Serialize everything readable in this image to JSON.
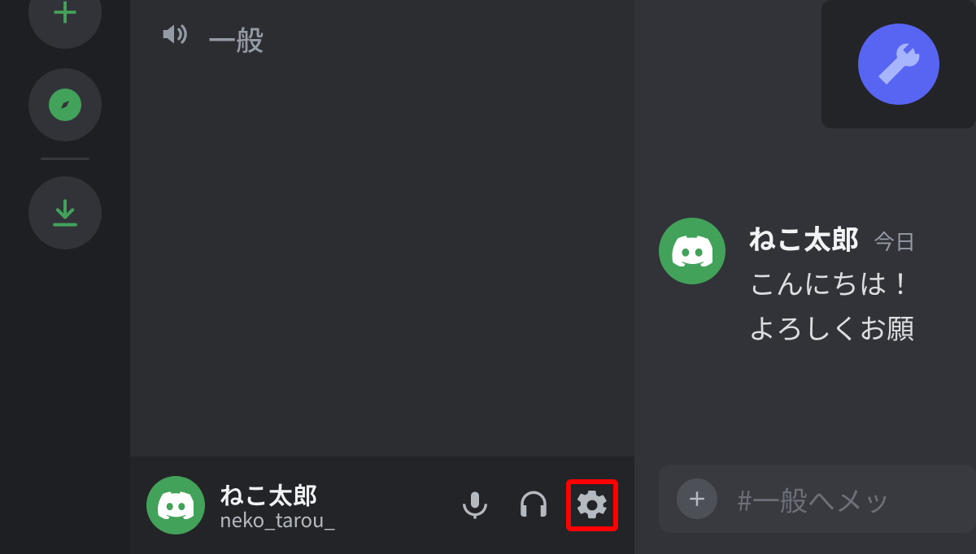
{
  "rail": {
    "add_icon": "plus-icon",
    "explore_icon": "compass-icon",
    "download_icon": "download-icon"
  },
  "channels": {
    "voice_channel_label": "一般"
  },
  "user_panel": {
    "display_name": "ねこ太郎",
    "username": "neko_tarou_"
  },
  "chat": {
    "message": {
      "author": "ねこ太郎",
      "timestamp": "今日",
      "line1": "こんにちは！",
      "line2": "よろしくお願"
    },
    "composer_placeholder": "#一般へメッ"
  },
  "colors": {
    "green": "#43a25a",
    "blurple": "#5865f2",
    "annotation_red": "#ff0000"
  }
}
